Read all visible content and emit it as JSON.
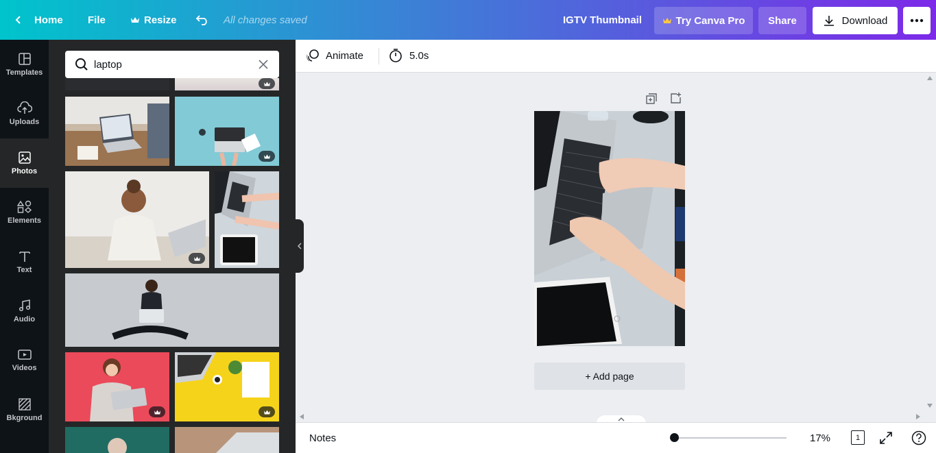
{
  "header": {
    "home_label": "Home",
    "file_label": "File",
    "resize_label": "Resize",
    "saved_status": "All changes saved",
    "doc_title": "IGTV Thumbnail",
    "try_pro_label": "Try Canva Pro",
    "share_label": "Share",
    "download_label": "Download"
  },
  "sidebar": {
    "items": [
      {
        "label": "Templates",
        "icon": "templates-icon"
      },
      {
        "label": "Uploads",
        "icon": "upload-icon"
      },
      {
        "label": "Photos",
        "icon": "photo-icon",
        "active": true
      },
      {
        "label": "Elements",
        "icon": "shapes-icon"
      },
      {
        "label": "Text",
        "icon": "text-icon"
      },
      {
        "label": "Audio",
        "icon": "music-icon"
      },
      {
        "label": "Videos",
        "icon": "video-icon"
      },
      {
        "label": "Bkground",
        "icon": "background-icon"
      }
    ]
  },
  "search": {
    "value": "laptop"
  },
  "toolbar": {
    "animate_label": "Animate",
    "duration": "5.0s"
  },
  "canvas": {
    "add_page_label": "+ Add page"
  },
  "footer": {
    "notes_label": "Notes",
    "zoom": "17%",
    "page_count": "1"
  },
  "colors": {
    "brand_start": "#00c4cc",
    "brand_end": "#7d2ae8",
    "rail": "#0e1318",
    "panel": "#252627"
  }
}
